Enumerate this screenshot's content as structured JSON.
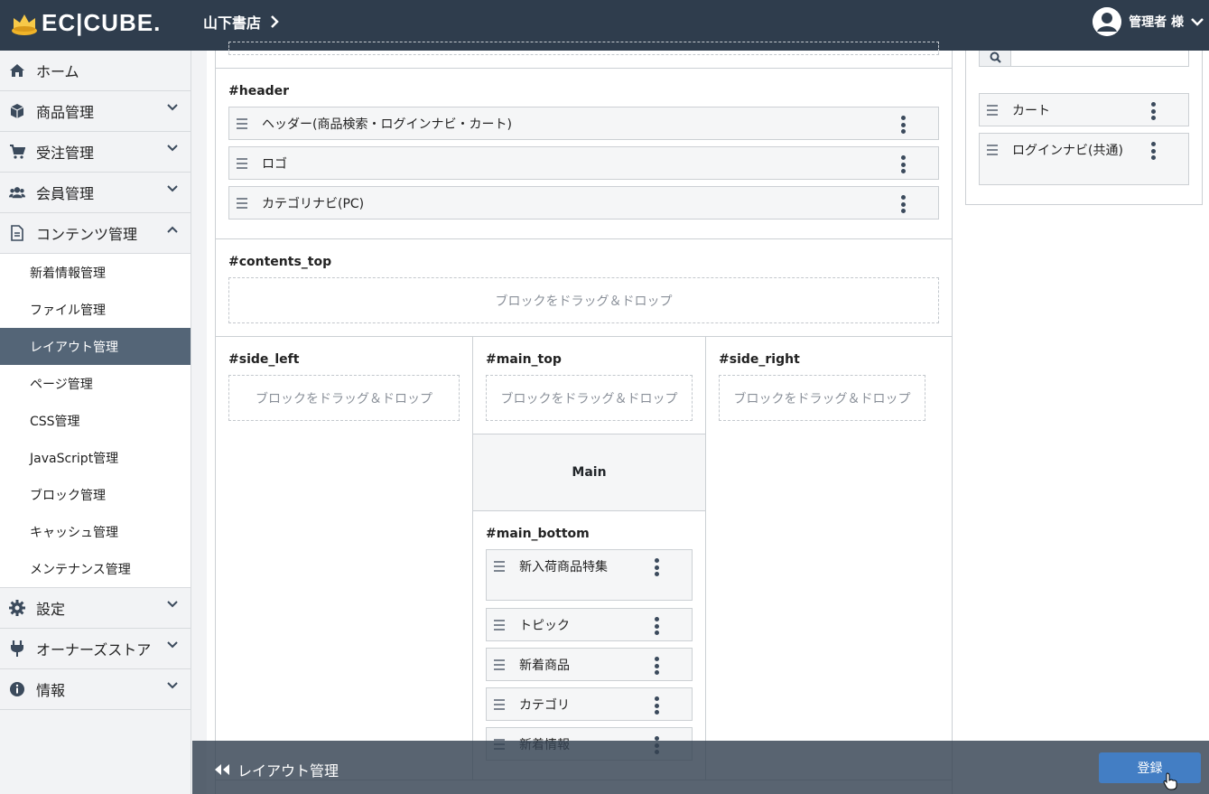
{
  "header": {
    "logo_text": "EC|CUBE.",
    "shop_name": "山下書店",
    "user_label": "管理者 様"
  },
  "sidebar": {
    "items": [
      {
        "label": "ホーム"
      },
      {
        "label": "商品管理"
      },
      {
        "label": "受注管理"
      },
      {
        "label": "会員管理"
      },
      {
        "label": "コンテンツ管理"
      },
      {
        "label": "設定"
      },
      {
        "label": "オーナーズストア"
      },
      {
        "label": "情報"
      }
    ],
    "content_sub": [
      {
        "label": "新着情報管理"
      },
      {
        "label": "ファイル管理"
      },
      {
        "label": "レイアウト管理"
      },
      {
        "label": "ページ管理"
      },
      {
        "label": "CSS管理"
      },
      {
        "label": "JavaScript管理"
      },
      {
        "label": "ブロック管理"
      },
      {
        "label": "キャッシュ管理"
      },
      {
        "label": "メンテナンス管理"
      }
    ]
  },
  "layout": {
    "drop_text": "ブロックをドラッグ＆ドロップ",
    "header_zone": {
      "title": "#header",
      "blocks": [
        "ヘッダー(商品検索・ログインナビ・カート)",
        "ロゴ",
        "カテゴリナビ(PC)"
      ]
    },
    "contents_top_zone": {
      "title": "#contents_top"
    },
    "side_left_zone": {
      "title": "#side_left"
    },
    "main_top_zone": {
      "title": "#main_top"
    },
    "side_right_zone": {
      "title": "#side_right"
    },
    "main_label": "Main",
    "main_bottom_zone": {
      "title": "#main_bottom",
      "blocks": [
        "新入荷商品特集",
        "トピック",
        "新着商品",
        "カテゴリ",
        "新着情報"
      ]
    }
  },
  "unused_blocks": {
    "search_placeholder": "",
    "blocks": [
      "カート",
      "ログインナビ(共通)"
    ]
  },
  "footer": {
    "back_label": "レイアウト管理",
    "save_label": "登録"
  },
  "colors": {
    "topbar": "#2f3d4d",
    "active_sub": "#546577",
    "primary": "#437ec4"
  }
}
